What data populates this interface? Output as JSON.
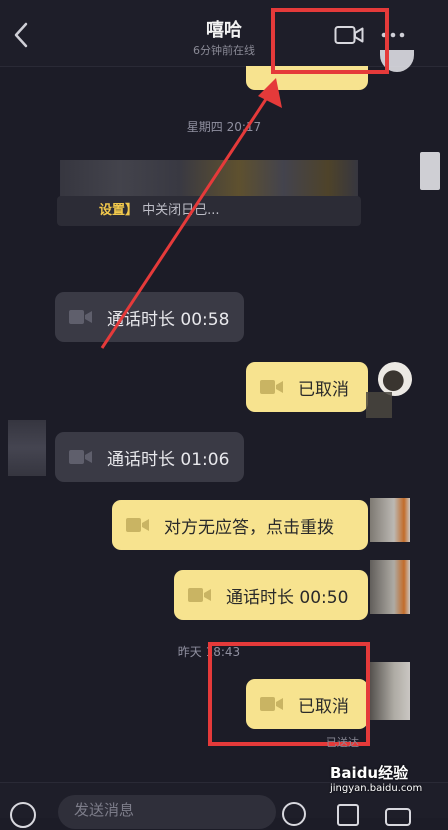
{
  "header": {
    "title": "嘻哈",
    "subtitle": "6分钟前在线"
  },
  "messages": {
    "ts_thursday": "星期四 20:17",
    "system_text_prefix": "设置】",
    "system_text_rest": "中关闭日己...",
    "call1": "通话时长 00:58",
    "cancel1": "已取消",
    "call2": "通话时长 01:06",
    "no_answer": "对方无应答，点击重拨",
    "call3": "通话时长 00:50",
    "ts_yesterday": "昨天 18:43",
    "cancel2": "已取消",
    "status_sent": "已送达"
  },
  "input": {
    "placeholder": "发送消息"
  },
  "watermark": {
    "brand": "Baidu经验",
    "url": "jingyan.baidu.com"
  },
  "colors": {
    "mine_bubble": "#f7e38f",
    "theirs_bubble": "#3a3a45",
    "annotation": "#e53a3a",
    "background": "#1c1c27"
  }
}
